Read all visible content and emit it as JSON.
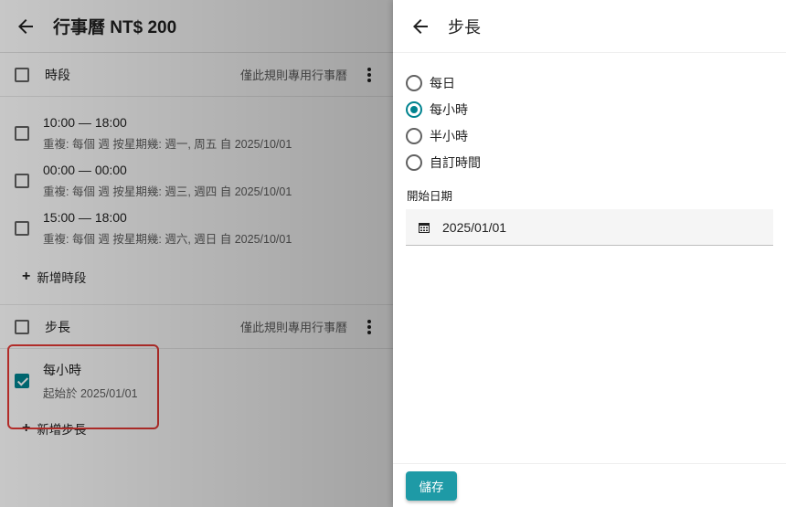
{
  "left_panel": {
    "title": "行事曆 NT$ 200",
    "time_section": {
      "label": "時段",
      "hint": "僅此規則專用行事曆",
      "rules": [
        {
          "time": "10:00 — 18:00",
          "detail": "重複: 每個 週 按星期幾: 週一, 周五 自 2025/10/01"
        },
        {
          "time": "00:00 — 00:00",
          "detail": "重複: 每個 週 按星期幾: 週三, 週四 自 2025/10/01"
        },
        {
          "time": "15:00 — 18:00",
          "detail": "重複: 每個 週 按星期幾: 週六, 週日 自 2025/10/01"
        }
      ],
      "add_label": "新增時段"
    },
    "step_section": {
      "label": "步長",
      "hint": "僅此規則專用行事曆",
      "item": {
        "title": "每小時",
        "detail": "起始於 2025/01/01",
        "checked": true
      },
      "add_label": "新增步長"
    }
  },
  "right_panel": {
    "title": "步長",
    "options": [
      {
        "label": "每日",
        "selected": false
      },
      {
        "label": "每小時",
        "selected": true
      },
      {
        "label": "半小時",
        "selected": false
      },
      {
        "label": "自訂時間",
        "selected": false
      }
    ],
    "start_date_label": "開始日期",
    "start_date_value": "2025/01/01",
    "save_label": "儲存"
  },
  "colors": {
    "accent": "#00838f",
    "save_button": "#1e9aa6",
    "highlight_border": "#e53935"
  },
  "icons": {
    "back": "arrow-left-icon",
    "calendar": "calendar-icon",
    "more": "more-vertical-icon",
    "add": "plus-icon"
  }
}
